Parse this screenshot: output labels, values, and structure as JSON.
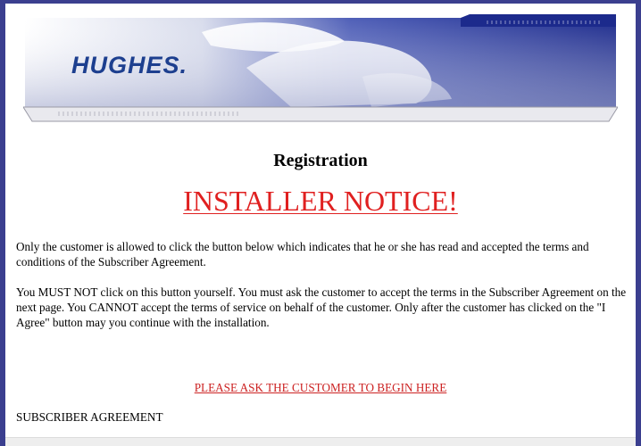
{
  "header": {
    "logo_text": "HUGHES",
    "logo_dot": "."
  },
  "main": {
    "title": "Registration",
    "notice": "INSTALLER NOTICE!",
    "paragraph1": "Only the customer is allowed to click the button below which indicates that he or she has read and accepted the terms and conditions of the Subscriber Agreement.",
    "paragraph2": "You MUST NOT click on this button yourself. You must ask the customer to accept the terms in the Subscriber Agreement on the next page. You CANNOT accept the terms of service on behalf of the customer. Only after the customer has clicked on the \"I Agree\" button may you continue with the installation.",
    "begin_link": "PLEASE ASK THE CUSTOMER TO BEGIN HERE",
    "subscriber_agreement": "SUBSCRIBER AGREEMENT"
  },
  "colors": {
    "frame": "#3b3f8f",
    "notice_red": "#e02020",
    "link_red": "#cc2222",
    "logo_blue": "#1d3f8f"
  }
}
